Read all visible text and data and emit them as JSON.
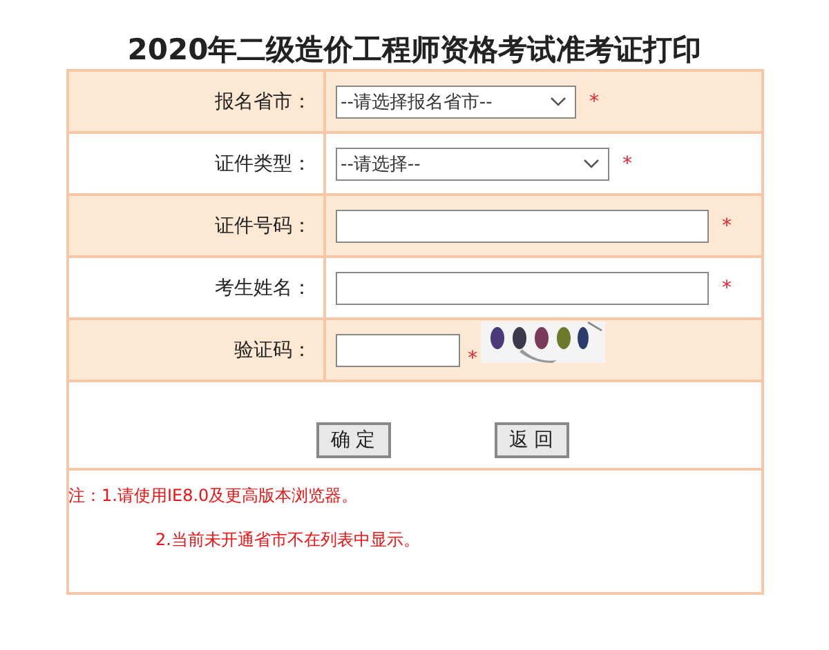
{
  "title": "2020年二级造价工程师资格考试准考证打印",
  "fields": [
    {
      "label": "报名省市：",
      "kind": "select",
      "value": "--请选择报名省市--",
      "mark": "*"
    },
    {
      "label": "证件类型：",
      "kind": "select",
      "value": "--请选择--",
      "mark": "*"
    },
    {
      "label": "证件号码：",
      "kind": "input",
      "mark": "*"
    },
    {
      "label": "考生姓名：",
      "kind": "input",
      "mark": "*"
    },
    {
      "label": "验证码：",
      "kind": "captcha",
      "mark": "*"
    }
  ],
  "buttons": [
    "确 定",
    "返 回"
  ],
  "notes": [
    "注：1.请使用IE8.0及更高版本浏览器。",
    "2.当前未开通省市不在列表中显示。"
  ]
}
